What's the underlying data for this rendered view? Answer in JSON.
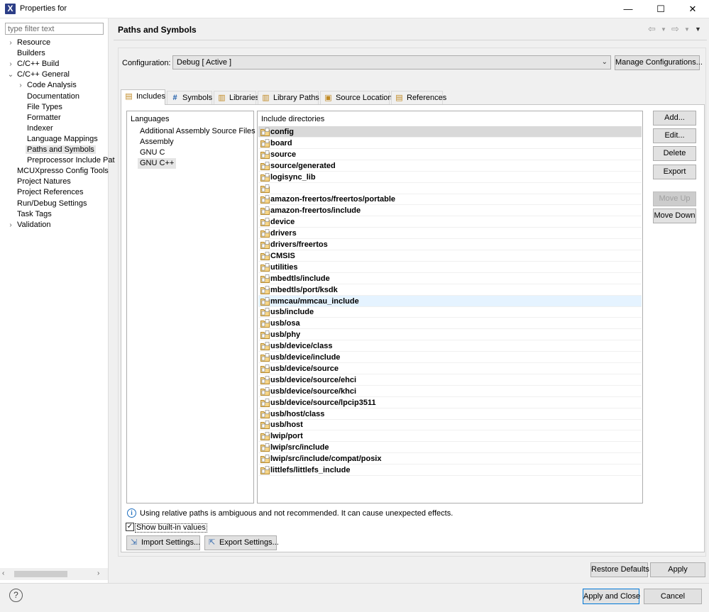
{
  "window": {
    "title": "Properties for",
    "minimize": "—",
    "maximize": "☐",
    "close": "✕"
  },
  "filter": {
    "placeholder": "type filter text",
    "value": ""
  },
  "tree": [
    {
      "label": "Resource",
      "arrow": "›",
      "indent": 0
    },
    {
      "label": "Builders",
      "arrow": "",
      "indent": 0
    },
    {
      "label": "C/C++ Build",
      "arrow": "›",
      "indent": 0
    },
    {
      "label": "C/C++ General",
      "arrow": "⌄",
      "indent": 0
    },
    {
      "label": "Code Analysis",
      "arrow": "›",
      "indent": 1
    },
    {
      "label": "Documentation",
      "arrow": "",
      "indent": 1
    },
    {
      "label": "File Types",
      "arrow": "",
      "indent": 1
    },
    {
      "label": "Formatter",
      "arrow": "",
      "indent": 1
    },
    {
      "label": "Indexer",
      "arrow": "",
      "indent": 1
    },
    {
      "label": "Language Mappings",
      "arrow": "",
      "indent": 1
    },
    {
      "label": "Paths and Symbols",
      "arrow": "",
      "indent": 1,
      "selected": true
    },
    {
      "label": "Preprocessor Include Pat",
      "arrow": "",
      "indent": 1
    },
    {
      "label": "MCUXpresso Config Tools",
      "arrow": "",
      "indent": 0
    },
    {
      "label": "Project Natures",
      "arrow": "",
      "indent": 0
    },
    {
      "label": "Project References",
      "arrow": "",
      "indent": 0
    },
    {
      "label": "Run/Debug Settings",
      "arrow": "",
      "indent": 0
    },
    {
      "label": "Task Tags",
      "arrow": "",
      "indent": 0
    },
    {
      "label": "Validation",
      "arrow": "›",
      "indent": 0
    }
  ],
  "page": {
    "title": "Paths and Symbols",
    "config_label": "Configuration:",
    "config_value": "Debug  [ Active ]",
    "manage_button": "Manage Configurations..."
  },
  "tabs": [
    {
      "label": "Includes",
      "icon": "includes-icon",
      "glyph": "▤",
      "active": true
    },
    {
      "label": "Symbols",
      "icon": "symbols-icon",
      "glyph": "#"
    },
    {
      "label": "Libraries",
      "icon": "libraries-icon",
      "glyph": "▥"
    },
    {
      "label": "Library Paths",
      "icon": "library-paths-icon",
      "glyph": "▥"
    },
    {
      "label": "Source Location",
      "icon": "source-location-icon",
      "glyph": "▣"
    },
    {
      "label": "References",
      "icon": "references-icon",
      "glyph": "▤"
    }
  ],
  "languages": {
    "header": "Languages",
    "items": [
      {
        "label": "Additional Assembly Source Files"
      },
      {
        "label": "Assembly"
      },
      {
        "label": "GNU C"
      },
      {
        "label": "GNU C++",
        "selected": true
      }
    ]
  },
  "includes": {
    "header": "Include directories",
    "items": [
      "config",
      "board",
      "source",
      "source/generated",
      "logisync_lib",
      "",
      "amazon-freertos/freertos/portable",
      "amazon-freertos/include",
      "device",
      "drivers",
      "drivers/freertos",
      "CMSIS",
      "utilities",
      "mbedtls/include",
      "mbedtls/port/ksdk",
      "mmcau/mmcau_include",
      "usb/include",
      "usb/osa",
      "usb/phy",
      "usb/device/class",
      "usb/device/include",
      "usb/device/source",
      "usb/device/source/ehci",
      "usb/device/source/khci",
      "usb/device/source/lpcip3511",
      "usb/host/class",
      "usb/host",
      "lwip/port",
      "lwip/src/include",
      "lwip/src/include/compat/posix",
      "littlefs/littlefs_include"
    ],
    "selected_index": 0,
    "hover_index": 15
  },
  "side_buttons": {
    "add": "Add...",
    "edit": "Edit...",
    "delete": "Delete",
    "export": "Export",
    "move_up": "Move Up",
    "move_down": "Move Down"
  },
  "info": {
    "icon": "i",
    "text": "Using relative paths is ambiguous and not recommended. It can cause unexpected effects."
  },
  "show_builtin": {
    "label": "Show built-in values",
    "checked": true,
    "mark": "✓"
  },
  "settings_buttons": {
    "import": "Import Settings...",
    "export": "Export Settings..."
  },
  "footer": {
    "restore": "Restore Defaults",
    "apply": "Apply",
    "apply_close": "Apply and Close",
    "cancel": "Cancel",
    "help": "?"
  }
}
